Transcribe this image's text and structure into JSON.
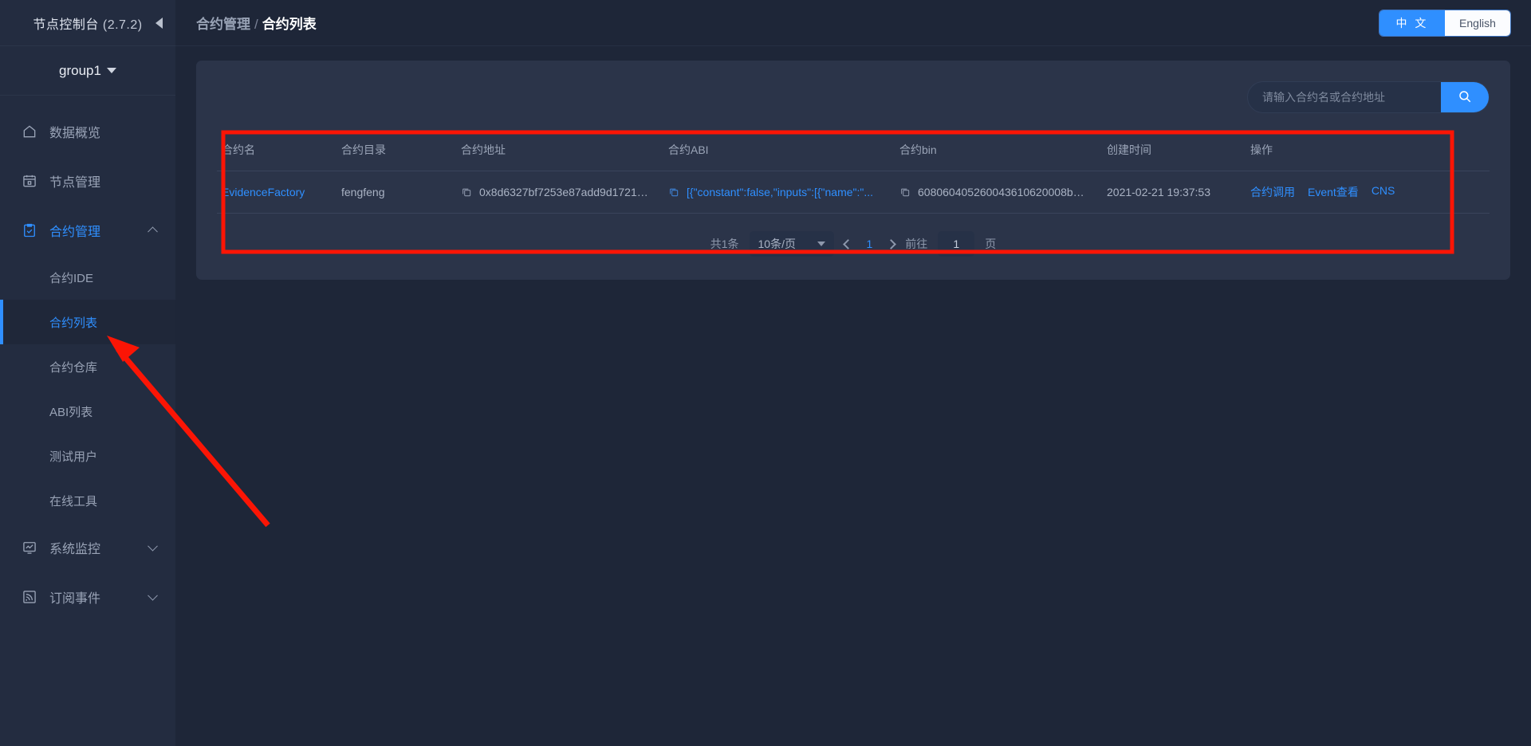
{
  "sidebar": {
    "brand_title": "节点控制台",
    "brand_version": "(2.7.2)",
    "collapse_icon": "caret-left-icon",
    "group": "group1",
    "items": [
      {
        "label": "数据概览",
        "icon": "home-icon"
      },
      {
        "label": "节点管理",
        "icon": "calendar-icon"
      },
      {
        "label": "合约管理",
        "icon": "clipboard-check-icon"
      }
    ],
    "submenu": [
      {
        "label": "合约IDE"
      },
      {
        "label": "合约列表"
      },
      {
        "label": "合约仓库"
      },
      {
        "label": "ABI列表"
      },
      {
        "label": "测试用户"
      },
      {
        "label": "在线工具"
      }
    ],
    "bottom_items": [
      {
        "label": "系统监控",
        "icon": "monitor-chart-icon"
      },
      {
        "label": "订阅事件",
        "icon": "rss-icon"
      }
    ]
  },
  "header": {
    "breadcrumb_parent": "合约管理",
    "breadcrumb_sep": "/",
    "breadcrumb_current": "合约列表",
    "lang_cn": "中 文",
    "lang_en": "English"
  },
  "search": {
    "value": "",
    "placeholder": "请输入合约名或合约地址",
    "button_icon": "search-icon"
  },
  "table": {
    "columns": [
      "合约名",
      "合约目录",
      "合约地址",
      "合约ABI",
      "合约bin",
      "创建时间",
      "操作"
    ],
    "rows": [
      {
        "name": "EvidenceFactory",
        "path": "fengfeng",
        "address": "0x8d6327bf7253e87add9d17212cc7...",
        "abi": "[{\"constant\":false,\"inputs\":[{\"name\":\"...",
        "bin": "608060405260043610620008b576...",
        "created": "2021-02-21 19:37:53",
        "actions": [
          "合约调用",
          "Event查看",
          "CNS"
        ]
      }
    ]
  },
  "pagination": {
    "total_text": "共1条",
    "page_size": "10条/页",
    "current_page": "1",
    "jump_prefix": "前往",
    "jump_value": "1",
    "jump_suffix": "页"
  },
  "colors": {
    "accent": "#2f8fff",
    "annotation": "#fb1505",
    "card_bg": "#2b3449",
    "page_bg": "#1e2638",
    "sidebar_bg": "#232c40"
  }
}
